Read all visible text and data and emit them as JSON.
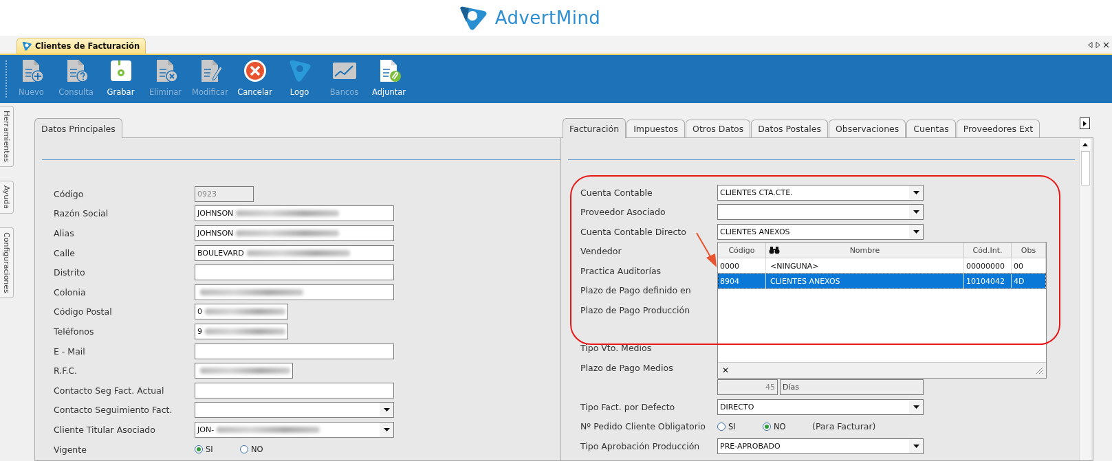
{
  "brand": {
    "name": "AdvertMind"
  },
  "document_tab": {
    "title": "Clientes de Facturación"
  },
  "toolbar": [
    {
      "label": "Nuevo",
      "kind": "new",
      "disabled": true
    },
    {
      "label": "Consulta",
      "kind": "query",
      "disabled": true
    },
    {
      "label": "Grabar",
      "kind": "save",
      "disabled": false
    },
    {
      "label": "Eliminar",
      "kind": "delete",
      "disabled": true
    },
    {
      "label": "Modificar",
      "kind": "edit",
      "disabled": true
    },
    {
      "label": "Cancelar",
      "kind": "cancel",
      "disabled": false
    },
    {
      "label": "Logo",
      "kind": "logo",
      "disabled": false
    },
    {
      "label": "Bancos",
      "kind": "chart",
      "disabled": true
    },
    {
      "label": "Adjuntar",
      "kind": "attach",
      "disabled": false
    }
  ],
  "side_tabs": [
    {
      "label": "Herramientas"
    },
    {
      "label": "Ayuda"
    },
    {
      "label": "Configuraciones"
    }
  ],
  "left_panel": {
    "tab": "Datos Principales",
    "fields": [
      {
        "label": "Código",
        "kind": "readonly",
        "value": "0923"
      },
      {
        "label": "Razón Social",
        "kind": "text",
        "value": "JOHNSON",
        "redacted": true
      },
      {
        "label": "Alias",
        "kind": "text",
        "value": "JOHNSON",
        "redacted": true
      },
      {
        "label": "Calle",
        "kind": "text",
        "value": "BOULEVARD",
        "redacted": true
      },
      {
        "label": "Distrito",
        "kind": "text"
      },
      {
        "label": "Colonia",
        "kind": "text",
        "redacted": true
      },
      {
        "label": "Código Postal",
        "kind": "text",
        "value": "0",
        "redacted": true
      },
      {
        "label": "Teléfonos",
        "kind": "text",
        "value": "9",
        "redacted": true
      },
      {
        "label": "E - Mail",
        "kind": "text"
      },
      {
        "label": "R.F.C.",
        "kind": "text",
        "redacted": true
      },
      {
        "label": "Contacto Seg Fact. Actual",
        "kind": "text"
      },
      {
        "label": "Contacto Seguimiento Fact.",
        "kind": "select"
      },
      {
        "label": "Cliente Titular Asociado",
        "kind": "select",
        "value": "JON-",
        "redacted": true
      },
      {
        "label": "Vigente",
        "kind": "radio",
        "options": [
          {
            "label": "SI",
            "selected": true
          },
          {
            "label": "NO",
            "selected": false
          }
        ]
      }
    ]
  },
  "right_panel": {
    "tabs": [
      {
        "label": "Facturación",
        "selected": true
      },
      {
        "label": "Impuestos",
        "selected": false
      },
      {
        "label": "Otros Datos",
        "selected": false
      },
      {
        "label": "Datos Postales",
        "selected": false
      },
      {
        "label": "Observaciones",
        "selected": false
      },
      {
        "label": "Cuentas",
        "selected": false
      },
      {
        "label": "Proveedores Ext",
        "selected": false
      }
    ],
    "fields": [
      {
        "label": "Cuenta Contable",
        "kind": "select",
        "value": "CLIENTES CTA.CTE."
      },
      {
        "label": "Proveedor Asociado",
        "kind": "select"
      },
      {
        "label": "Cuenta Contable Directo",
        "kind": "select",
        "value": "CLIENTES ANEXOS"
      },
      {
        "label": "Vendedor",
        "kind": "covered"
      },
      {
        "label": "Practica Auditorías",
        "kind": "covered"
      },
      {
        "label": "Plazo de Pago definido en",
        "kind": "covered"
      },
      {
        "label": "Plazo de Pago Producción",
        "kind": "covered"
      },
      {
        "kind": "gap"
      },
      {
        "label": "Tipo Vto. Medios",
        "kind": "covered"
      },
      {
        "label": "Plazo de Pago Medios",
        "kind": "covered"
      },
      {
        "kind": "days",
        "value": "45",
        "unit": "Días"
      },
      {
        "label": "Tipo Fact. por Defecto",
        "kind": "select",
        "value": "DIRECTO"
      },
      {
        "label": "Nº Pedido Cliente Obligatorio",
        "kind": "radio",
        "options": [
          {
            "label": "SI",
            "selected": false
          },
          {
            "label": "NO",
            "selected": true
          }
        ],
        "note": "(Para Facturar)"
      },
      {
        "label": "Tipo Aprobación Producción",
        "kind": "select",
        "value": "PRE-APROBADO"
      }
    ],
    "lookup": {
      "columns": [
        "Código",
        "Nombre",
        "Cód.Int.",
        "Obs"
      ],
      "rows": [
        {
          "cells": [
            "0000",
            "<NINGUNA>",
            "00000000",
            "00"
          ],
          "selected": false
        },
        {
          "cells": [
            "8904",
            "CLIENTES ANEXOS",
            "10104042",
            "4D"
          ],
          "selected": true
        }
      ],
      "close": "✕"
    }
  }
}
